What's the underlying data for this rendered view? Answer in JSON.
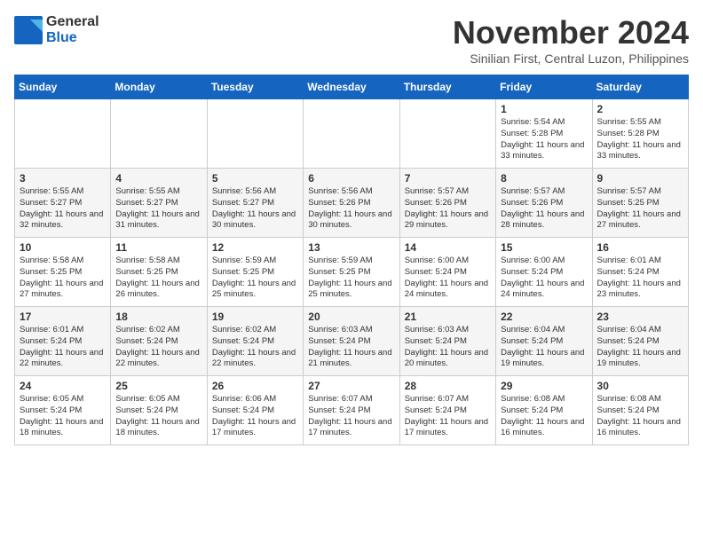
{
  "header": {
    "logo_general": "General",
    "logo_blue": "Blue",
    "month_title": "November 2024",
    "location": "Sinilian First, Central Luzon, Philippines"
  },
  "days_of_week": [
    "Sunday",
    "Monday",
    "Tuesday",
    "Wednesday",
    "Thursday",
    "Friday",
    "Saturday"
  ],
  "weeks": [
    [
      {
        "day": "",
        "info": ""
      },
      {
        "day": "",
        "info": ""
      },
      {
        "day": "",
        "info": ""
      },
      {
        "day": "",
        "info": ""
      },
      {
        "day": "",
        "info": ""
      },
      {
        "day": "1",
        "info": "Sunrise: 5:54 AM\nSunset: 5:28 PM\nDaylight: 11 hours and 33 minutes."
      },
      {
        "day": "2",
        "info": "Sunrise: 5:55 AM\nSunset: 5:28 PM\nDaylight: 11 hours and 33 minutes."
      }
    ],
    [
      {
        "day": "3",
        "info": "Sunrise: 5:55 AM\nSunset: 5:27 PM\nDaylight: 11 hours and 32 minutes."
      },
      {
        "day": "4",
        "info": "Sunrise: 5:55 AM\nSunset: 5:27 PM\nDaylight: 11 hours and 31 minutes."
      },
      {
        "day": "5",
        "info": "Sunrise: 5:56 AM\nSunset: 5:27 PM\nDaylight: 11 hours and 30 minutes."
      },
      {
        "day": "6",
        "info": "Sunrise: 5:56 AM\nSunset: 5:26 PM\nDaylight: 11 hours and 30 minutes."
      },
      {
        "day": "7",
        "info": "Sunrise: 5:57 AM\nSunset: 5:26 PM\nDaylight: 11 hours and 29 minutes."
      },
      {
        "day": "8",
        "info": "Sunrise: 5:57 AM\nSunset: 5:26 PM\nDaylight: 11 hours and 28 minutes."
      },
      {
        "day": "9",
        "info": "Sunrise: 5:57 AM\nSunset: 5:25 PM\nDaylight: 11 hours and 27 minutes."
      }
    ],
    [
      {
        "day": "10",
        "info": "Sunrise: 5:58 AM\nSunset: 5:25 PM\nDaylight: 11 hours and 27 minutes."
      },
      {
        "day": "11",
        "info": "Sunrise: 5:58 AM\nSunset: 5:25 PM\nDaylight: 11 hours and 26 minutes."
      },
      {
        "day": "12",
        "info": "Sunrise: 5:59 AM\nSunset: 5:25 PM\nDaylight: 11 hours and 25 minutes."
      },
      {
        "day": "13",
        "info": "Sunrise: 5:59 AM\nSunset: 5:25 PM\nDaylight: 11 hours and 25 minutes."
      },
      {
        "day": "14",
        "info": "Sunrise: 6:00 AM\nSunset: 5:24 PM\nDaylight: 11 hours and 24 minutes."
      },
      {
        "day": "15",
        "info": "Sunrise: 6:00 AM\nSunset: 5:24 PM\nDaylight: 11 hours and 24 minutes."
      },
      {
        "day": "16",
        "info": "Sunrise: 6:01 AM\nSunset: 5:24 PM\nDaylight: 11 hours and 23 minutes."
      }
    ],
    [
      {
        "day": "17",
        "info": "Sunrise: 6:01 AM\nSunset: 5:24 PM\nDaylight: 11 hours and 22 minutes."
      },
      {
        "day": "18",
        "info": "Sunrise: 6:02 AM\nSunset: 5:24 PM\nDaylight: 11 hours and 22 minutes."
      },
      {
        "day": "19",
        "info": "Sunrise: 6:02 AM\nSunset: 5:24 PM\nDaylight: 11 hours and 22 minutes."
      },
      {
        "day": "20",
        "info": "Sunrise: 6:03 AM\nSunset: 5:24 PM\nDaylight: 11 hours and 21 minutes."
      },
      {
        "day": "21",
        "info": "Sunrise: 6:03 AM\nSunset: 5:24 PM\nDaylight: 11 hours and 20 minutes."
      },
      {
        "day": "22",
        "info": "Sunrise: 6:04 AM\nSunset: 5:24 PM\nDaylight: 11 hours and 19 minutes."
      },
      {
        "day": "23",
        "info": "Sunrise: 6:04 AM\nSunset: 5:24 PM\nDaylight: 11 hours and 19 minutes."
      }
    ],
    [
      {
        "day": "24",
        "info": "Sunrise: 6:05 AM\nSunset: 5:24 PM\nDaylight: 11 hours and 18 minutes."
      },
      {
        "day": "25",
        "info": "Sunrise: 6:05 AM\nSunset: 5:24 PM\nDaylight: 11 hours and 18 minutes."
      },
      {
        "day": "26",
        "info": "Sunrise: 6:06 AM\nSunset: 5:24 PM\nDaylight: 11 hours and 17 minutes."
      },
      {
        "day": "27",
        "info": "Sunrise: 6:07 AM\nSunset: 5:24 PM\nDaylight: 11 hours and 17 minutes."
      },
      {
        "day": "28",
        "info": "Sunrise: 6:07 AM\nSunset: 5:24 PM\nDaylight: 11 hours and 17 minutes."
      },
      {
        "day": "29",
        "info": "Sunrise: 6:08 AM\nSunset: 5:24 PM\nDaylight: 11 hours and 16 minutes."
      },
      {
        "day": "30",
        "info": "Sunrise: 6:08 AM\nSunset: 5:24 PM\nDaylight: 11 hours and 16 minutes."
      }
    ]
  ]
}
